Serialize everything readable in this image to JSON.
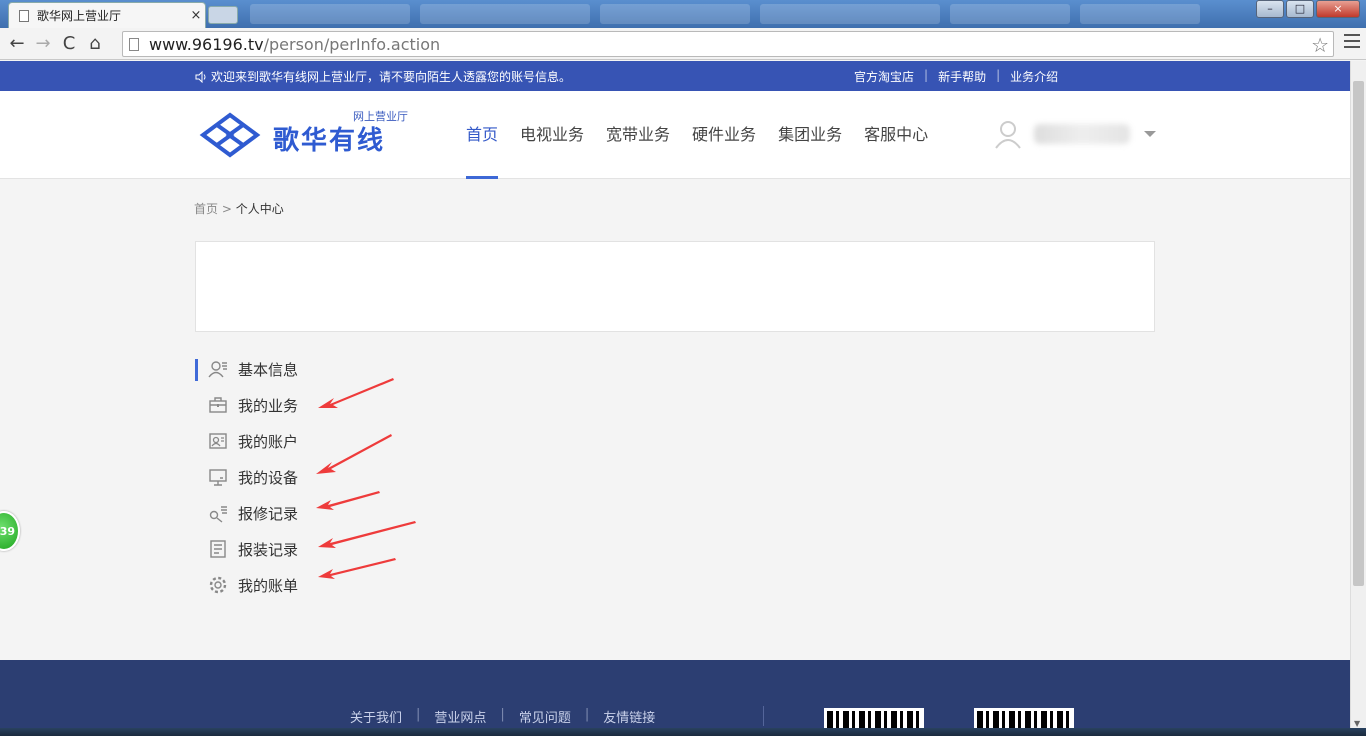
{
  "browser": {
    "tab_title": "歌华网上营业厅",
    "tab_close": "×",
    "url_host": "www.96196.tv",
    "url_path": "/person/perInfo.action",
    "back_label": "←",
    "forward_label": "→",
    "reload_label": "C",
    "home_label": "⌂",
    "star_label": "☆",
    "win_min": "–",
    "win_max": "□",
    "win_close": "×"
  },
  "topbar": {
    "welcome": "欢迎来到歌华有线网上营业厅，请不要向陌生人透露您的账号信息。",
    "links": [
      "官方淘宝店",
      "新手帮助",
      "业务介绍"
    ]
  },
  "header": {
    "logo_sub": "网上营业厅",
    "logo_main": "歌华有线",
    "nav": [
      "首页",
      "电视业务",
      "宽带业务",
      "硬件业务",
      "集团业务",
      "客服中心"
    ],
    "active_nav_index": 0
  },
  "breadcrumb": {
    "home": "首页",
    "separator": ">",
    "current": "个人中心"
  },
  "side_menu": {
    "items": [
      {
        "label": "基本信息",
        "icon": "user-info-icon"
      },
      {
        "label": "我的业务",
        "icon": "briefcase-icon"
      },
      {
        "label": "我的账户",
        "icon": "id-card-icon"
      },
      {
        "label": "我的设备",
        "icon": "monitor-icon"
      },
      {
        "label": "报修记录",
        "icon": "wrench-icon"
      },
      {
        "label": "报装记录",
        "icon": "document-icon"
      },
      {
        "label": "我的账单",
        "icon": "gear-icon"
      }
    ],
    "active_index": 0
  },
  "float_badge": "39",
  "footer": {
    "links": [
      "关于我们",
      "营业网点",
      "常见问题",
      "友情链接"
    ]
  },
  "colors": {
    "topbar": "#3754b4",
    "brand_blue": "#2f5bd1",
    "footer": "#2c3e72",
    "annotation_arrow": "#ee3b3b"
  }
}
